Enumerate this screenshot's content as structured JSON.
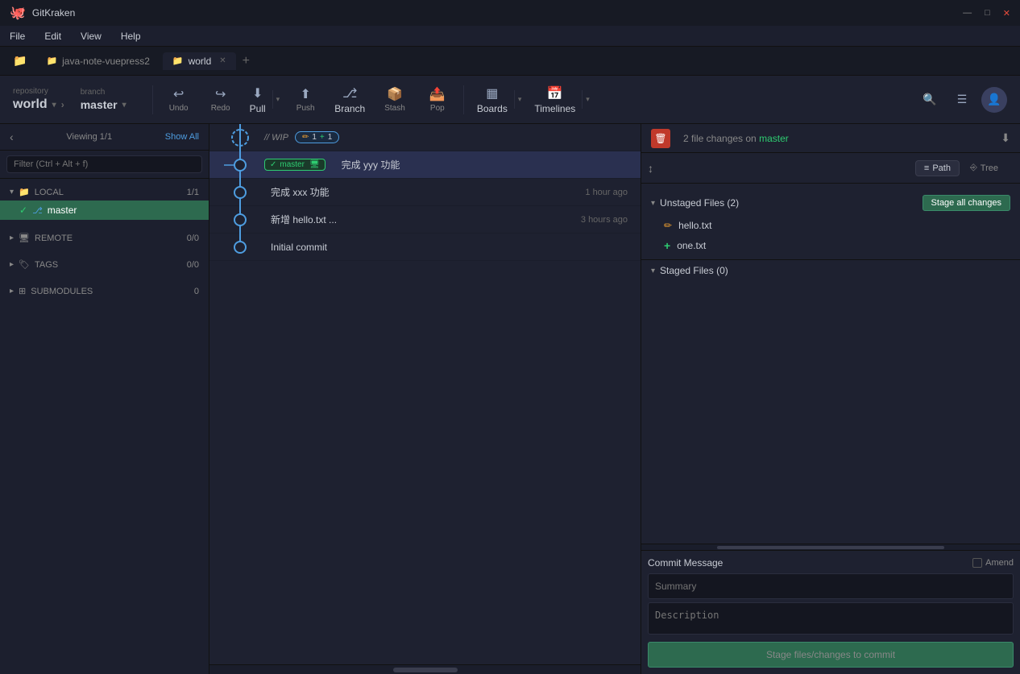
{
  "app": {
    "title": "GitKraken",
    "logo": "🐙"
  },
  "titlebar": {
    "title": "GitKraken",
    "minimize": "—",
    "maximize": "□",
    "close": "✕"
  },
  "menubar": {
    "items": [
      "File",
      "Edit",
      "View",
      "Help"
    ]
  },
  "tabs": [
    {
      "label": "java-note-vuepress2",
      "active": false,
      "closeable": false
    },
    {
      "label": "world",
      "active": true,
      "closeable": true
    }
  ],
  "toolbar": {
    "repo_label": "repository",
    "repo_name": "world",
    "branch_label": "branch",
    "branch_name": "master",
    "undo_label": "Undo",
    "redo_label": "Redo",
    "pull_label": "Pull",
    "push_label": "Push",
    "branch_btn_label": "Branch",
    "stash_label": "Stash",
    "pop_label": "Pop",
    "boards_label": "Boards",
    "timelines_label": "Timelines"
  },
  "sidebar": {
    "viewing": "Viewing 1/1",
    "show_all": "Show All",
    "filter_placeholder": "Filter (Ctrl + Alt + f)",
    "local_label": "LOCAL",
    "local_count": "1/1",
    "master_branch": "master",
    "remote_label": "REMOTE",
    "remote_count": "0/0",
    "tags_label": "TAGS",
    "tags_count": "0/0",
    "submodules_label": "SUBMODULES",
    "submodules_count": "0"
  },
  "graph": {
    "commits": [
      {
        "msg": "// WIP",
        "time": "",
        "is_wip": true,
        "edit_count": "1",
        "plus_count": "1"
      },
      {
        "msg": "完成 yyy 功能",
        "time": "",
        "is_master": true
      },
      {
        "msg": "完成 xxx 功能",
        "time": "1 hour ago"
      },
      {
        "msg": "新增 hello.txt ...",
        "time": "3 hours ago"
      },
      {
        "msg": "Initial commit",
        "time": ""
      }
    ]
  },
  "right_panel": {
    "file_changes_label": "2 file changes on",
    "branch_name": "master",
    "path_label": "Path",
    "tree_label": "Tree",
    "unstaged_label": "Unstaged Files (2)",
    "stage_all_label": "Stage all changes",
    "staged_label": "Staged Files (0)",
    "unstaged_files": [
      {
        "name": "hello.txt",
        "status": "modified"
      },
      {
        "name": "one.txt",
        "status": "added"
      }
    ],
    "commit_message_label": "Commit Message",
    "amend_label": "Amend",
    "summary_placeholder": "Summary",
    "description_placeholder": "Description",
    "commit_btn_label": "Stage files/changes to commit"
  },
  "icons": {
    "check": "✓",
    "chevron_down": "▾",
    "chevron_right": "▸",
    "search": "🔍",
    "menu": "☰",
    "folder": "📁",
    "branch_icon": "⎇",
    "undo": "↩",
    "redo": "↪",
    "download": "⬇",
    "upload": "⬆",
    "pencil": "✏",
    "trash": "🗑",
    "sort": "↕",
    "path_icon": "≡",
    "tree_icon": "⎆",
    "plus": "+",
    "tag": "🏷",
    "repo": "📦",
    "timelines_icon": "📅"
  }
}
